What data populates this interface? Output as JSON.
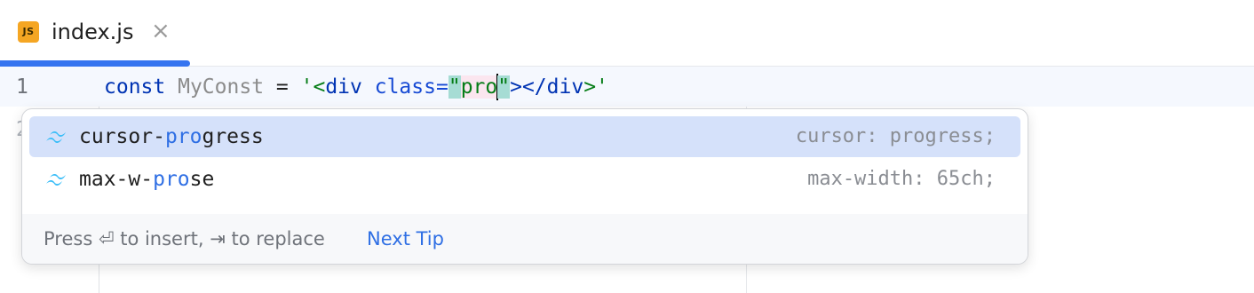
{
  "tab": {
    "icon_text": "JS",
    "title": "index.js",
    "close_glyph": "×"
  },
  "editor": {
    "line_numbers": [
      "1",
      "2"
    ],
    "code": {
      "kw": "const",
      "ident": "MyConst",
      "eq": "=",
      "open": "'<",
      "tag_open": "div",
      "attr": "class",
      "attr_eq": "=",
      "q1": "\"",
      "typed": "pro",
      "q2": "\"",
      "close_gt": "></",
      "tag_close": "div",
      "end": ">'"
    }
  },
  "completion": {
    "items": [
      {
        "pre": "cursor-",
        "match": "pro",
        "post": "gress",
        "tail": "cursor: progress;",
        "icon": "tailwind-icon"
      },
      {
        "pre": "max-w-",
        "match": "pro",
        "post": "se",
        "tail": "max-width: 65ch;",
        "icon": "tailwind-icon"
      }
    ],
    "footer": "Press ⏎ to insert, ⇥ to replace",
    "next_tip": "Next Tip"
  },
  "colors": {
    "accent": "#3574f0",
    "selection": "#d5e1fa",
    "match": "#2f6fe4"
  }
}
